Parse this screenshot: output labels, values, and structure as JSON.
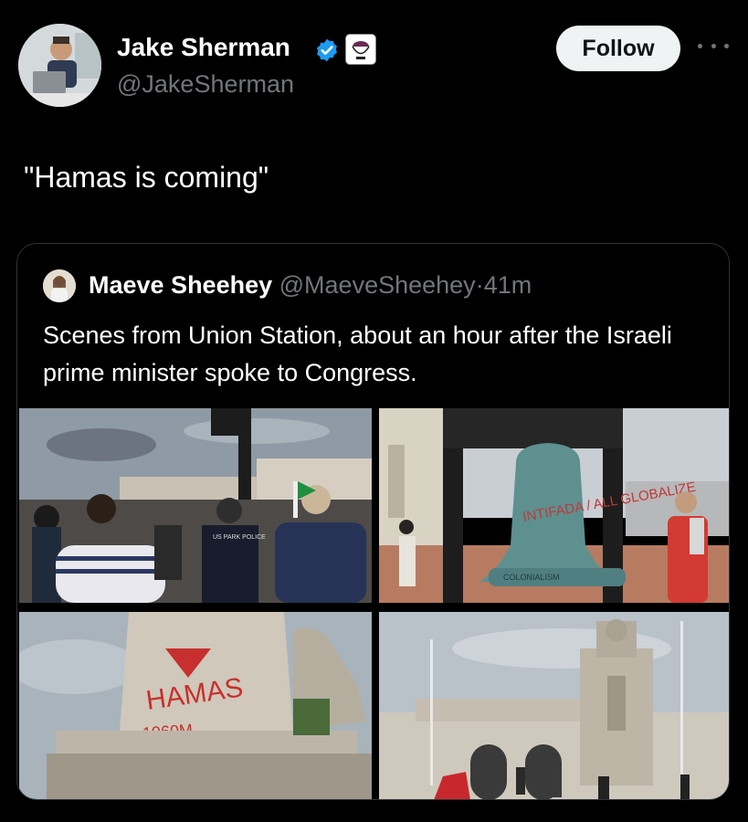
{
  "author": {
    "name": "Jake Sherman",
    "handle": "@JakeSherman",
    "follow_label": "Follow",
    "verified_color": "#1d9bf0"
  },
  "tweet": {
    "text": "\"Hamas is coming\""
  },
  "quoted_tweet": {
    "name": "Maeve Sheehey",
    "handle": "@MaeveSheehey",
    "separator": "·",
    "time": "41m",
    "text": "Scenes from Union Station, about an hour after the Israeli prime minister spoke to Congress."
  },
  "photos": [
    {
      "name": "protest-police-photo",
      "text": "US PARK POLICE"
    },
    {
      "name": "liberty-bell-replica-photo",
      "text": "INTIFADA / ALL GLOBALIZE",
      "bell_bottom_text": "COLONIALISM"
    },
    {
      "name": "graffiti-monument-photo",
      "text": "HAMAS",
      "sub_text": "1960M"
    },
    {
      "name": "union-station-fountain-photo"
    }
  ],
  "icons": {
    "verified": "verified-badge-icon",
    "affiliation": "affiliation-badge-icon",
    "more": "more-options-icon"
  }
}
